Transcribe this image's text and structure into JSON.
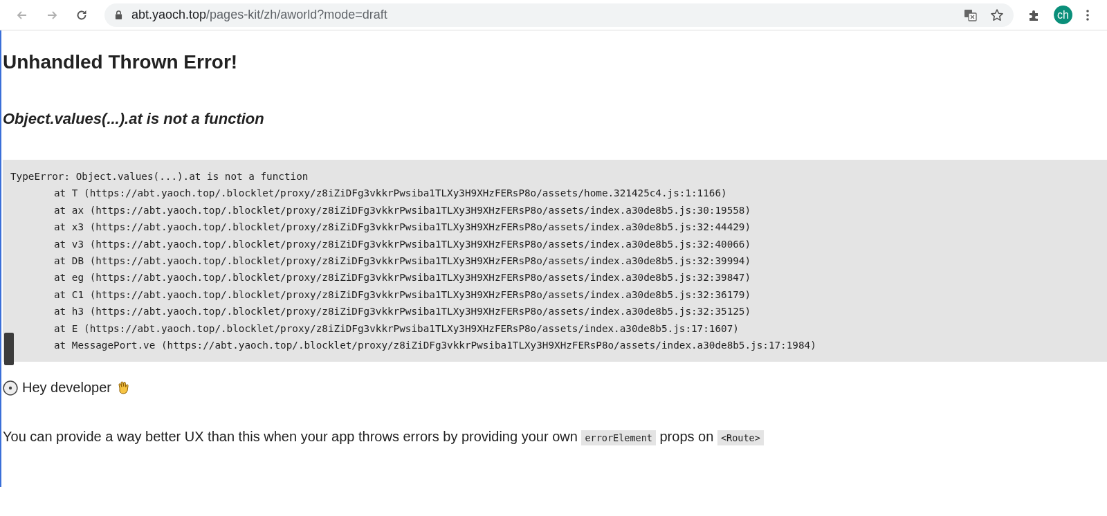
{
  "browser": {
    "url_host": "abt.yaoch.top",
    "url_path": "/pages-kit/zh/aworld?mode=draft",
    "profile": "ch"
  },
  "page": {
    "title": "Unhandled Thrown Error!",
    "subtitle": "Object.values(...).at is not a function",
    "stack": {
      "message": "TypeError: Object.values(...).at is not a function",
      "frames": [
        "at T (https://abt.yaoch.top/.blocklet/proxy/z8iZiDFg3vkkrPwsiba1TLXy3H9XHzFERsP8o/assets/home.321425c4.js:1:1166)",
        "at ax (https://abt.yaoch.top/.blocklet/proxy/z8iZiDFg3vkkrPwsiba1TLXy3H9XHzFERsP8o/assets/index.a30de8b5.js:30:19558)",
        "at x3 (https://abt.yaoch.top/.blocklet/proxy/z8iZiDFg3vkkrPwsiba1TLXy3H9XHzFERsP8o/assets/index.a30de8b5.js:32:44429)",
        "at v3 (https://abt.yaoch.top/.blocklet/proxy/z8iZiDFg3vkkrPwsiba1TLXy3H9XHzFERsP8o/assets/index.a30de8b5.js:32:40066)",
        "at DB (https://abt.yaoch.top/.blocklet/proxy/z8iZiDFg3vkkrPwsiba1TLXy3H9XHzFERsP8o/assets/index.a30de8b5.js:32:39994)",
        "at eg (https://abt.yaoch.top/.blocklet/proxy/z8iZiDFg3vkkrPwsiba1TLXy3H9XHzFERsP8o/assets/index.a30de8b5.js:32:39847)",
        "at C1 (https://abt.yaoch.top/.blocklet/proxy/z8iZiDFg3vkkrPwsiba1TLXy3H9XHzFERsP8o/assets/index.a30de8b5.js:32:36179)",
        "at h3 (https://abt.yaoch.top/.blocklet/proxy/z8iZiDFg3vkkrPwsiba1TLXy3H9XHzFERsP8o/assets/index.a30de8b5.js:32:35125)",
        "at E (https://abt.yaoch.top/.blocklet/proxy/z8iZiDFg3vkkrPwsiba1TLXy3H9XHzFERsP8o/assets/index.a30de8b5.js:17:1607)",
        "at MessagePort.ve (https://abt.yaoch.top/.blocklet/proxy/z8iZiDFg3vkkrPwsiba1TLXy3H9XHzFERsP8o/assets/index.a30de8b5.js:17:1984)"
      ]
    },
    "greeting": "Hey developer",
    "hint": [
      {
        "kind": "text",
        "text": "You can provide a way better UX than this when your app throws errors by providing your own"
      },
      {
        "kind": "code",
        "text": "errorElement"
      },
      {
        "kind": "text",
        "text": "props on"
      },
      {
        "kind": "code",
        "text": "<Route>"
      }
    ]
  }
}
